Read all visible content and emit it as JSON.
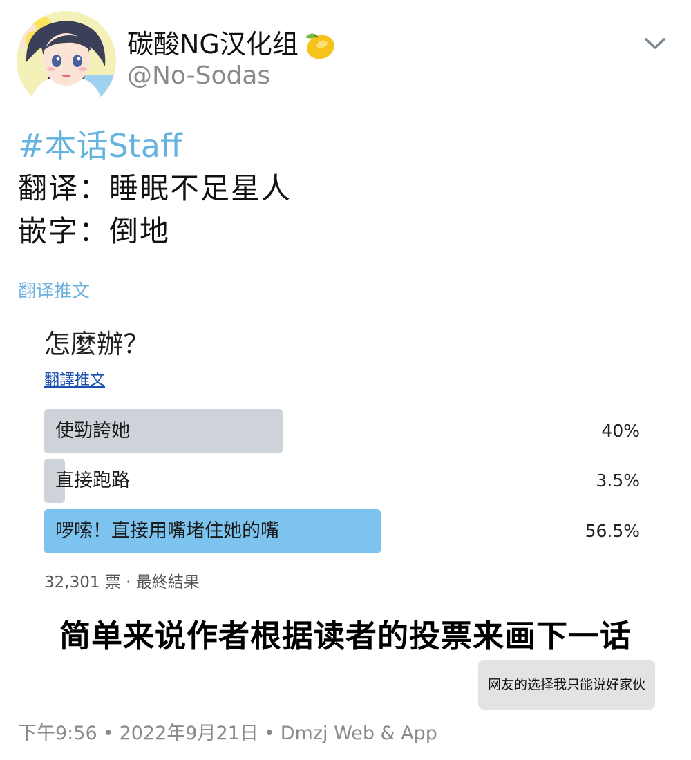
{
  "header": {
    "display_name": "碳酸NG汉化组",
    "handle": "@No-Sodas",
    "lemon_icon": "lemon-icon",
    "menu_icon": "chevron-down-icon"
  },
  "tweet": {
    "hashtag": "#本话Staff",
    "lines": [
      "翻译：睡眠不足星人",
      "嵌字：倒地"
    ],
    "translate_label": "翻译推文"
  },
  "poll": {
    "question": "怎麼辦？",
    "translate_label": "翻譯推文",
    "options": [
      {
        "label": "使勁誇她",
        "percent_text": "40%",
        "fraction": 0.4,
        "winner": false
      },
      {
        "label": "直接跑路",
        "percent_text": "3.5%",
        "fraction": 0.035,
        "winner": false
      },
      {
        "label": "啰嗦！直接用嘴堵住她的嘴",
        "percent_text": "56.5%",
        "fraction": 0.565,
        "winner": true
      }
    ],
    "footer": "32,301 票 · 最終結果"
  },
  "overlay": {
    "summary": "简单来说作者根据读者的投票来画下一话",
    "comment": "网友的选择我只能说好家伙"
  },
  "meta": {
    "time": "下午9:56",
    "separator": "•",
    "date": "2022年9月21日",
    "source": "Dmzj Web & App"
  },
  "colors": {
    "link_blue": "#66b3e1",
    "poll_bar_gray": "#cdd3d9",
    "poll_bar_winner": "#7dc3ef",
    "meta_gray": "#8a8a8a"
  }
}
